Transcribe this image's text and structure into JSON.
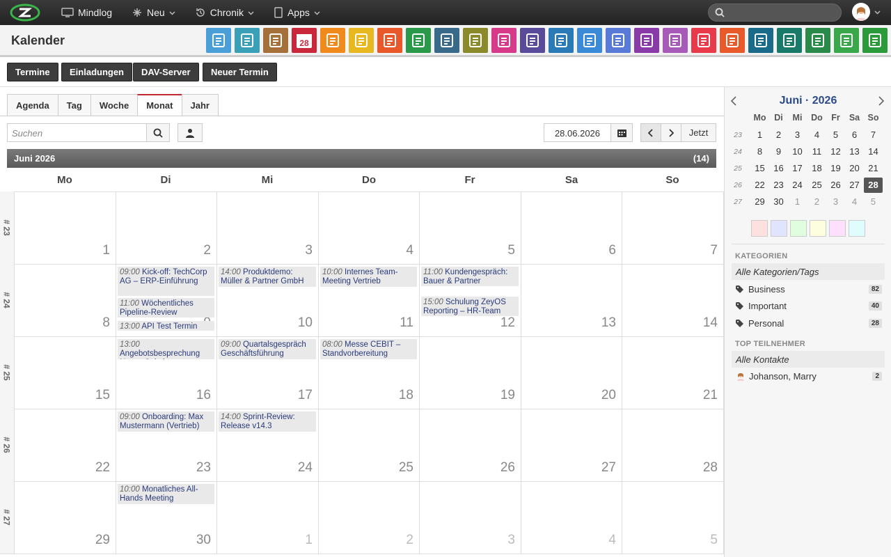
{
  "topbar": {
    "brand_icon": "zeyos-logo-icon",
    "nav": [
      {
        "label": "Mindlog",
        "icon": "monitor-icon"
      },
      {
        "label": "Neu",
        "icon": "sparkle-icon"
      },
      {
        "label": "Chronik",
        "icon": "history-icon"
      },
      {
        "label": "Apps",
        "icon": "tablet-icon"
      }
    ],
    "search_placeholder": ""
  },
  "header": {
    "title": "Kalender",
    "app_icons": [
      {
        "name": "mail-icon",
        "color": "#4a9fd8"
      },
      {
        "name": "address-book-icon",
        "color": "#3aa0b8"
      },
      {
        "name": "contacts-icon",
        "color": "#a5703a"
      },
      {
        "name": "calendar-icon",
        "color": "#c8283a",
        "text": "28"
      },
      {
        "name": "stopwatch-icon",
        "color": "#f08a1c"
      },
      {
        "name": "tasks-icon",
        "color": "#e8b820"
      },
      {
        "name": "folder-check-icon",
        "color": "#e8582a"
      },
      {
        "name": "notes-icon",
        "color": "#2a9a4a"
      },
      {
        "name": "bookmark-icon",
        "color": "#3a6a8a"
      },
      {
        "name": "document-icon",
        "color": "#8a8a2a"
      },
      {
        "name": "store-icon",
        "color": "#d83a8a"
      },
      {
        "name": "dollar-icon",
        "color": "#5a4a9a"
      },
      {
        "name": "truck-icon",
        "color": "#2a7ab8"
      },
      {
        "name": "support-icon",
        "color": "#3a8ad8"
      },
      {
        "name": "money-bag-icon",
        "color": "#5a7ad8"
      },
      {
        "name": "certificate-icon",
        "color": "#8a3aa8"
      },
      {
        "name": "handshake-icon",
        "color": "#a85ab8"
      },
      {
        "name": "pdf-icon",
        "color": "#e83a4a"
      },
      {
        "name": "broadcast-icon",
        "color": "#e85a2a"
      },
      {
        "name": "inbox-download-icon",
        "color": "#1a6a8a"
      },
      {
        "name": "cart-icon",
        "color": "#1a7a6a"
      },
      {
        "name": "cash-icon",
        "color": "#2a8a4a"
      },
      {
        "name": "price-tag-icon",
        "color": "#3aa84a"
      },
      {
        "name": "database-icon",
        "color": "#2a9a3a"
      }
    ]
  },
  "actions": [
    "Termine",
    "Einladungen",
    "DAV-Server",
    "Neuer Termin"
  ],
  "view_tabs": [
    "Agenda",
    "Tag",
    "Woche",
    "Monat",
    "Jahr"
  ],
  "toolbar": {
    "search_placeholder": "Suchen",
    "date_value": "28.06.2026",
    "today_label": "Jetzt"
  },
  "month": {
    "title": "Juni 2026",
    "count": "(14)"
  },
  "weekdays": [
    "Mo",
    "Di",
    "Mi",
    "Do",
    "Fr",
    "Sa",
    "So"
  ],
  "weeks": [
    {
      "label": "# 23",
      "days": [
        "1",
        "2",
        "3",
        "4",
        "5",
        "6",
        "7"
      ],
      "other": [
        false,
        false,
        false,
        false,
        false,
        false,
        false
      ]
    },
    {
      "label": "# 24",
      "days": [
        "8",
        "9",
        "10",
        "11",
        "12",
        "13",
        "14"
      ],
      "other": [
        false,
        false,
        false,
        false,
        false,
        false,
        false
      ]
    },
    {
      "label": "# 25",
      "days": [
        "15",
        "16",
        "17",
        "18",
        "19",
        "20",
        "21"
      ],
      "other": [
        false,
        false,
        false,
        false,
        false,
        false,
        false
      ]
    },
    {
      "label": "# 26",
      "days": [
        "22",
        "23",
        "24",
        "25",
        "26",
        "27",
        "28"
      ],
      "other": [
        false,
        false,
        false,
        false,
        false,
        false,
        false
      ]
    },
    {
      "label": "# 27",
      "days": [
        "29",
        "30",
        "1",
        "2",
        "3",
        "4",
        "5"
      ],
      "other": [
        false,
        false,
        true,
        true,
        true,
        true,
        true
      ]
    }
  ],
  "events": [
    {
      "week": 1,
      "day": 1,
      "slot": 0,
      "time": "09:00",
      "title": "Kick-off: TechCorp AG – ERP-Einführung"
    },
    {
      "week": 1,
      "day": 1,
      "slot": 1,
      "time": "11:00",
      "title": "Wöchentliches Pipeline-Review"
    },
    {
      "week": 1,
      "day": 1,
      "slot": 2,
      "time": "13:00",
      "title": "API Test Termin"
    },
    {
      "week": 1,
      "day": 2,
      "slot": 0,
      "time": "14:00",
      "title": "Produktdemo: Müller & Partner GmbH"
    },
    {
      "week": 1,
      "day": 3,
      "slot": 0,
      "time": "10:00",
      "title": "Internes Team-Meeting Vertrieb"
    },
    {
      "week": 1,
      "day": 4,
      "slot": 0,
      "time": "11:00",
      "title": "Kundengespräch: Bauer & Partner"
    },
    {
      "week": 1,
      "day": 4,
      "slot": 1,
      "time": "15:00",
      "title": "Schulung ZeyOS Reporting – HR-Team"
    },
    {
      "week": 2,
      "day": 1,
      "slot": 0,
      "time": "13:00",
      "title": "Angebotsbesprechung Nexus Solutions"
    },
    {
      "week": 2,
      "day": 2,
      "slot": 0,
      "time": "09:00",
      "title": "Quartalsgespräch Geschäftsführung"
    },
    {
      "week": 2,
      "day": 3,
      "slot": 0,
      "time": "08:00",
      "title": "Messe CEBIT – Standvorbereitung"
    },
    {
      "week": 3,
      "day": 1,
      "slot": 0,
      "time": "09:00",
      "title": "Onboarding: Max Mustermann (Vertrieb)"
    },
    {
      "week": 3,
      "day": 2,
      "slot": 0,
      "time": "14:00",
      "title": "Sprint-Review: Release v14.3"
    },
    {
      "week": 4,
      "day": 1,
      "slot": 0,
      "time": "10:00",
      "title": "Monatliches All-Hands Meeting"
    }
  ],
  "mini_calendar": {
    "title": "Juni · 2026",
    "weekdays": [
      "Mo",
      "Di",
      "Mi",
      "Do",
      "Fr",
      "Sa",
      "So"
    ],
    "weeks": [
      {
        "wk": "23",
        "days": [
          "1",
          "2",
          "3",
          "4",
          "5",
          "6",
          "7"
        ]
      },
      {
        "wk": "24",
        "days": [
          "8",
          "9",
          "10",
          "11",
          "12",
          "13",
          "14"
        ]
      },
      {
        "wk": "25",
        "days": [
          "15",
          "16",
          "17",
          "18",
          "19",
          "20",
          "21"
        ]
      },
      {
        "wk": "26",
        "days": [
          "22",
          "23",
          "24",
          "25",
          "26",
          "27",
          "28"
        ]
      },
      {
        "wk": "27",
        "days": [
          "29",
          "30",
          "1",
          "2",
          "3",
          "4",
          "5"
        ]
      }
    ],
    "today": "28",
    "swatches": [
      "#fde0e0",
      "#e0e4fd",
      "#e0fde0",
      "#fdfde0",
      "#fde0fd",
      "#e0fdfd"
    ]
  },
  "categories": {
    "title": "KATEGORIEN",
    "all_label": "Alle Kategorien/Tags",
    "items": [
      {
        "label": "Business",
        "count": "82"
      },
      {
        "label": "Important",
        "count": "40"
      },
      {
        "label": "Personal",
        "count": "28"
      }
    ]
  },
  "participants": {
    "title": "TOP TEILNEHMER",
    "all_label": "Alle Kontakte",
    "items": [
      {
        "label": "Johanson, Marry",
        "count": "2"
      }
    ]
  }
}
